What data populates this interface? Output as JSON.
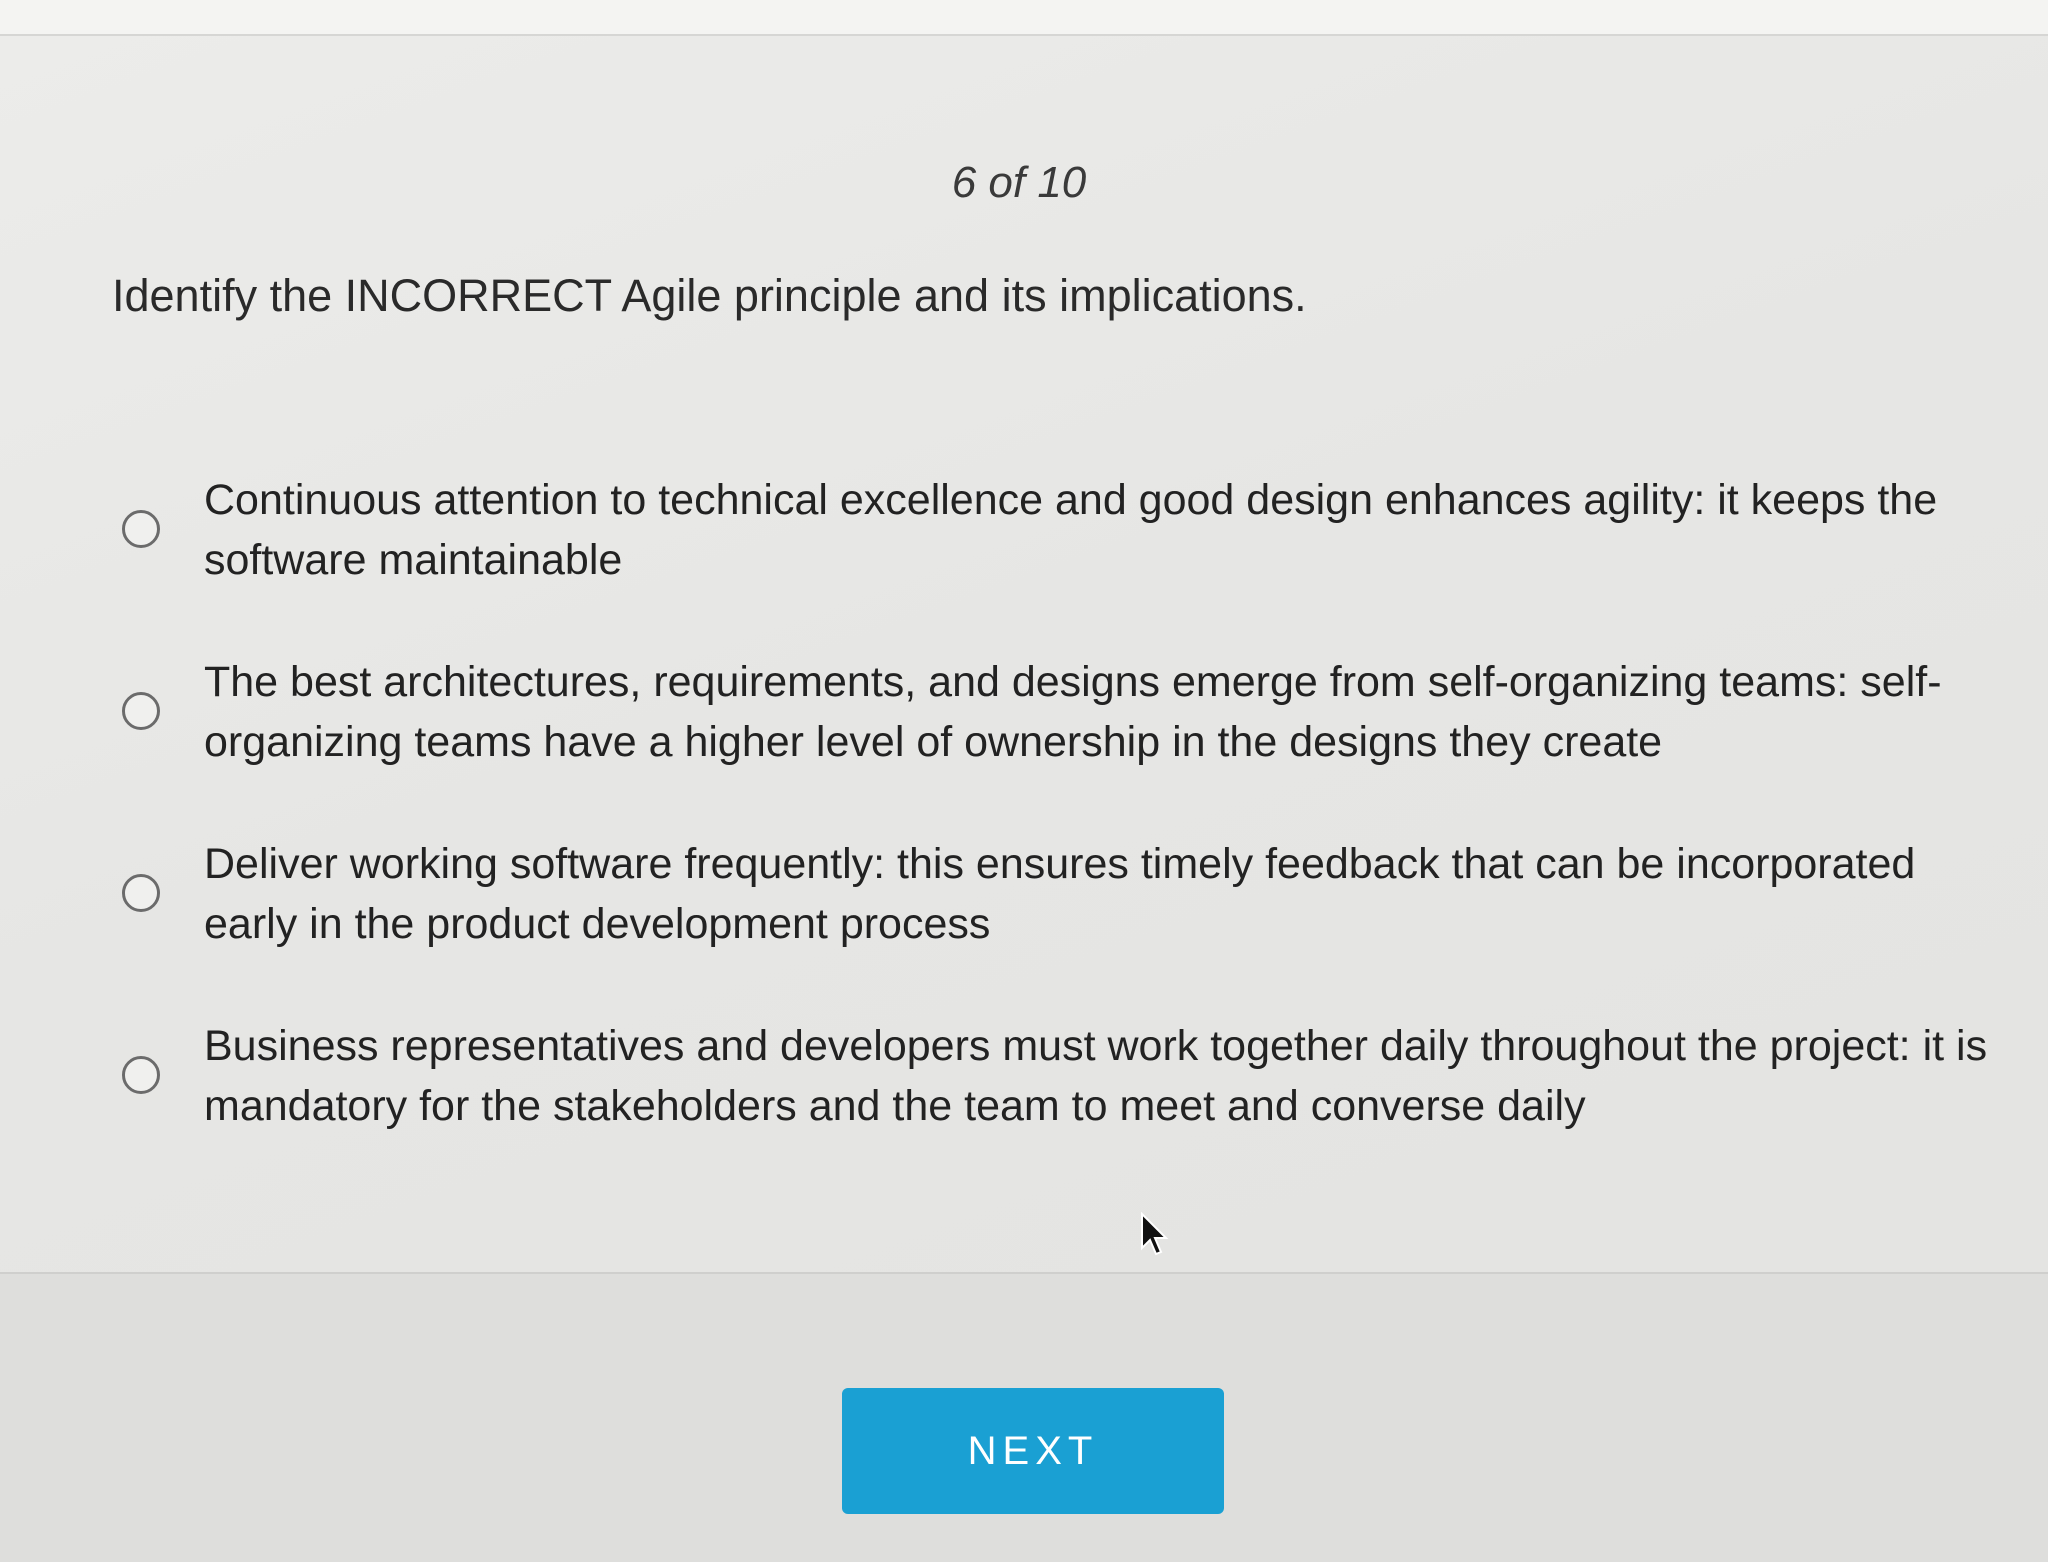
{
  "quiz": {
    "progress": "6 of 10",
    "question": "Identify the INCORRECT Agile principle and its implications.",
    "options": [
      {
        "label": "Continuous attention to technical excellence and good design enhances agility: it keeps the software maintainable"
      },
      {
        "label": "The best architectures, requirements, and designs emerge from self-organizing teams: self-organizing teams have a higher level of ownership in the designs they create"
      },
      {
        "label": "Deliver working software frequently: this ensures timely feedback that can be incorporated early in the product development process"
      },
      {
        "label": "Business representatives and developers must work together daily throughout the project: it is mandatory for the stakeholders and the team to meet and converse daily"
      }
    ]
  },
  "footer": {
    "next_label": "NEXT"
  },
  "colors": {
    "accent": "#1aa0d3",
    "background": "#e6e6e4"
  },
  "icons": {
    "cursor": "mouse-pointer-icon",
    "radio": "radio-unchecked-icon"
  }
}
